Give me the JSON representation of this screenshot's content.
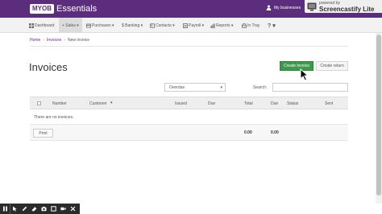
{
  "header": {
    "logo_badge": "MYOB",
    "logo_text": "Essentials",
    "business_label": "My businesses"
  },
  "watermark": {
    "line1": "powered by",
    "line2": "Screencastify Lite"
  },
  "nav": {
    "items": [
      {
        "label": "Dashboard",
        "icon": "dashboard-icon"
      },
      {
        "label": "+ Sales ▾",
        "icon": "none"
      },
      {
        "label": "Purchases ▾",
        "icon": "purchases-icon"
      },
      {
        "label": "$ Banking ▾",
        "icon": "none"
      },
      {
        "label": "Contacts ▾",
        "icon": "contacts-icon"
      },
      {
        "label": "Payroll ▾",
        "icon": "payroll-icon"
      },
      {
        "label": "Reports ▾",
        "icon": "reports-icon"
      },
      {
        "label": "In Tray",
        "icon": "in-tray-icon"
      }
    ],
    "help": "? ▾"
  },
  "breadcrumb": {
    "home": "Home",
    "invoices": "Invoices",
    "current": "New invoice",
    "separator": "›"
  },
  "page": {
    "title": "Invoices",
    "create_invoice_button": "Create invoice",
    "create_return_button": "Create return"
  },
  "filters": {
    "status_selected": "Overdue",
    "search_label": "Search:",
    "search_value": ""
  },
  "table": {
    "columns": [
      "Number",
      "Customer",
      "Issued",
      "Due",
      "Total",
      "Due",
      "Status",
      "Sent"
    ],
    "empty_message": "There are no invoices.",
    "print_button": "Print",
    "total_amount": "0.00",
    "total_due": "0.00"
  },
  "toolbar": {
    "tools": [
      "pause-icon",
      "pointer-icon",
      "pen-icon",
      "eraser-icon",
      "camera-icon",
      "square-icon",
      "video-icon",
      "close-icon"
    ]
  },
  "colors": {
    "brand_purple": "#5c2d7d",
    "primary_green": "#3d9a4a"
  }
}
